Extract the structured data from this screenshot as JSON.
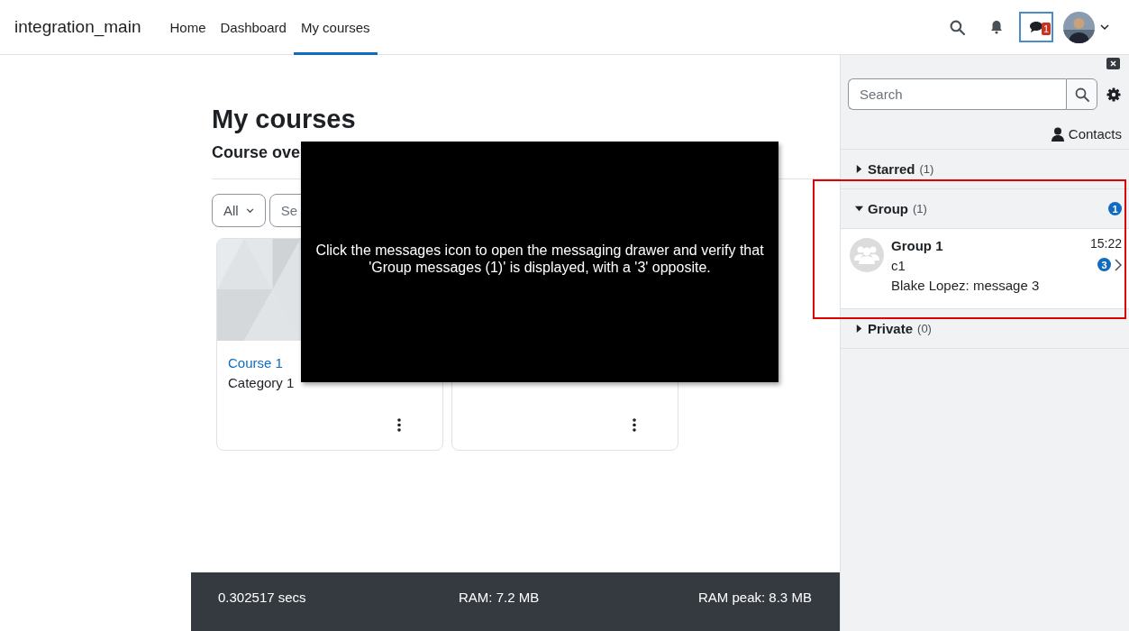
{
  "navbar": {
    "brand": "integration_main",
    "links": [
      {
        "label": "Home",
        "selected": false
      },
      {
        "label": "Dashboard",
        "selected": false
      },
      {
        "label": "My courses",
        "selected": true
      }
    ],
    "messages_button": {
      "badge": "1",
      "focused": true
    }
  },
  "page": {
    "title": "My courses",
    "section_title": "Course ove",
    "filter": {
      "label": "All"
    },
    "search": {
      "placeholder": "Se"
    },
    "courses": [
      {
        "kind": "course",
        "name": "Course 1",
        "category": "Category 1"
      },
      {
        "kind": "course"
      }
    ]
  },
  "drawer": {
    "search": {
      "placeholder": "Search"
    },
    "contacts_label": "Contacts",
    "sections": [
      {
        "title": "Starred",
        "count": "(1)",
        "expanded": false
      },
      {
        "title": "Group",
        "count": "(1)",
        "expanded": true,
        "badge": "1",
        "conversations": [
          {
            "name": "Group 1",
            "time": "15:22",
            "subtitle": "c1",
            "last_message": "Blake Lopez: message 3",
            "unread": "3"
          }
        ]
      },
      {
        "title": "Private",
        "count": "(0)",
        "expanded": false
      }
    ]
  },
  "footer": {
    "rows": [
      [
        "0.302517 secs",
        "RAM: 7.2 MB",
        "RAM peak: 8.3 MB"
      ]
    ]
  },
  "tooltip": {
    "message": "Click the messages icon to open the messaging drawer and verify that 'Group messages (1)' is displayed, with a '3' opposite."
  }
}
